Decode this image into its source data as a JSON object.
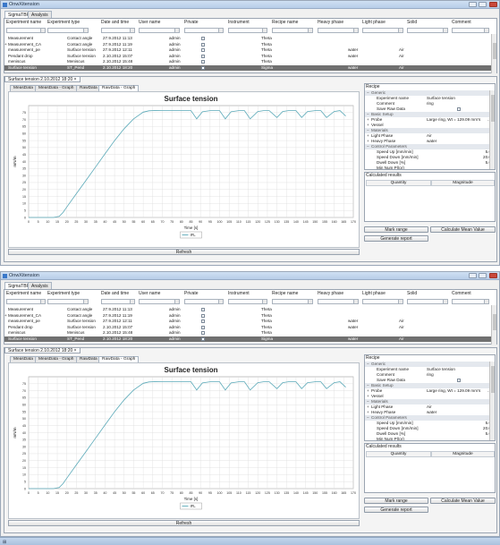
{
  "window_title": "OnwXitension",
  "main_tabs": [
    "SigmaTBP",
    "Analysis"
  ],
  "grid": {
    "columns": [
      "Experiment name",
      "Experiment type",
      "Date and time",
      "User name",
      "Private",
      "Instrument",
      "Recipe name",
      "Heavy phase",
      "Light phase",
      "Solid",
      "Comment"
    ],
    "rows": [
      {
        "name": "Measurement",
        "type": "Contact angle",
        "datetime": "27.9.2012 11:13",
        "user": "admin",
        "private": true,
        "instrument": "Theta",
        "recipe": "",
        "heavy": "",
        "light": "",
        "solid": "",
        "comment": "",
        "expander": ""
      },
      {
        "name": "Measurement_CA",
        "type": "Contact angle",
        "datetime": "27.9.2012 11:19",
        "user": "admin",
        "private": true,
        "instrument": "Theta",
        "recipe": "",
        "heavy": "",
        "light": "",
        "solid": "",
        "comment": "",
        "expander": "+"
      },
      {
        "name": "measurement_pe",
        "type": "Surface tension",
        "datetime": "27.9.2012 12:11",
        "user": "admin",
        "private": true,
        "instrument": "Theta",
        "recipe": "",
        "heavy": "water",
        "light": "Air",
        "solid": "",
        "comment": "",
        "expander": ""
      },
      {
        "name": "Pendant drop",
        "type": "Surface tension",
        "datetime": "2.10.2012 15:07",
        "user": "admin",
        "private": true,
        "instrument": "Theta",
        "recipe": "",
        "heavy": "water",
        "light": "Air",
        "solid": "",
        "comment": "",
        "expander": ""
      },
      {
        "name": "meniscus",
        "type": "Meniscus",
        "datetime": "2.10.2012 15:48",
        "user": "admin",
        "private": true,
        "instrument": "Theta",
        "recipe": "",
        "heavy": "",
        "light": "",
        "solid": "",
        "comment": "",
        "expander": ""
      },
      {
        "name": "Surface tension",
        "type": "ST_Pend",
        "datetime": "2.10.2012 18:20",
        "user": "admin",
        "private": true,
        "instrument": "Sigma",
        "recipe": "",
        "heavy": "water",
        "light": "Air",
        "solid": "",
        "comment": "",
        "expander": ""
      }
    ]
  },
  "doc_tab": "Surface tension 2.10.2012 18:20",
  "sub_tabs": [
    "MeasData",
    "MeasData - Graph",
    "RawData",
    "RawData - Graph"
  ],
  "refresh_label": "Refresh",
  "recipe": {
    "header": "Recipe",
    "rows": [
      {
        "kind": "cat",
        "key": "Generic",
        "value": ""
      },
      {
        "kind": "prop",
        "key": "Experiment name",
        "value": "Surface tension"
      },
      {
        "kind": "prop",
        "key": "Comment",
        "value": "ring"
      },
      {
        "kind": "check",
        "key": "Save Raw Data",
        "value": ""
      },
      {
        "kind": "cat",
        "key": "Basic Setup",
        "value": ""
      },
      {
        "kind": "exp",
        "key": "Probe",
        "value": "Large ring, Wt = 129.09 mm's",
        "suffix": "..."
      },
      {
        "kind": "exp",
        "key": "Vessel",
        "value": ""
      },
      {
        "kind": "cat",
        "key": "Materials",
        "value": ""
      },
      {
        "kind": "exp",
        "key": "Light Phase",
        "value": "Air"
      },
      {
        "kind": "exp",
        "key": "Heavy Phase",
        "value": "water"
      },
      {
        "kind": "cat",
        "key": "Control Parameters",
        "value": ""
      },
      {
        "kind": "num",
        "key": "Speed Up [mm/min]",
        "value": "5.0"
      },
      {
        "kind": "num",
        "key": "Speed Down [mm/min]",
        "value": "20.0"
      },
      {
        "kind": "num",
        "key": "Dwell Down [%]",
        "value": "5.0"
      },
      {
        "kind": "num",
        "key": "Min Num Pl(or)",
        "value": ""
      }
    ]
  },
  "results": {
    "header": "Calculated results",
    "columns": [
      "Quantity",
      "Magnitude"
    ],
    "buttons": [
      "Mark range",
      "Calculate Mean Value",
      "Generate report"
    ]
  },
  "chart_data": {
    "type": "line",
    "title": "Surface tension",
    "xlabel": "Time [s]",
    "ylabel": "mN/m",
    "xlim": [
      0,
      170
    ],
    "ylim": [
      0,
      80
    ],
    "xticks": [
      0,
      5,
      10,
      15,
      20,
      25,
      30,
      35,
      40,
      45,
      50,
      55,
      60,
      65,
      70,
      75,
      80,
      85,
      90,
      95,
      100,
      105,
      110,
      115,
      120,
      125,
      130,
      135,
      140,
      145,
      150,
      155,
      160,
      165,
      170
    ],
    "yticks": [
      0,
      5,
      10,
      15,
      20,
      25,
      30,
      35,
      40,
      45,
      50,
      55,
      60,
      65,
      70,
      75
    ],
    "grid": true,
    "legend": "bottom-center",
    "series": [
      {
        "name": "IFL",
        "color": "#5aa9b8",
        "x": [
          0,
          13,
          16,
          18,
          20,
          25,
          30,
          35,
          40,
          45,
          50,
          55,
          60,
          63,
          66,
          70,
          75,
          80,
          85,
          88,
          91,
          95,
          100,
          103,
          106,
          110,
          113,
          116,
          120,
          123,
          126,
          130,
          133,
          136,
          140,
          143,
          146,
          150,
          153,
          156,
          160,
          163,
          166
        ],
        "y": [
          0,
          0,
          0.8,
          3.5,
          7.5,
          17,
          26.5,
          36,
          45.5,
          55,
          63.5,
          70.5,
          75.3,
          76.3,
          76.5,
          76.4,
          76.4,
          76.4,
          76.4,
          70.5,
          75.6,
          76.4,
          76.4,
          70.5,
          75.6,
          76.4,
          76.4,
          70.5,
          75.8,
          76.4,
          76.4,
          71.5,
          75.8,
          76.4,
          76.4,
          71.5,
          75.8,
          76.4,
          76.4,
          71.5,
          75.8,
          76.4,
          72.5
        ]
      }
    ]
  }
}
